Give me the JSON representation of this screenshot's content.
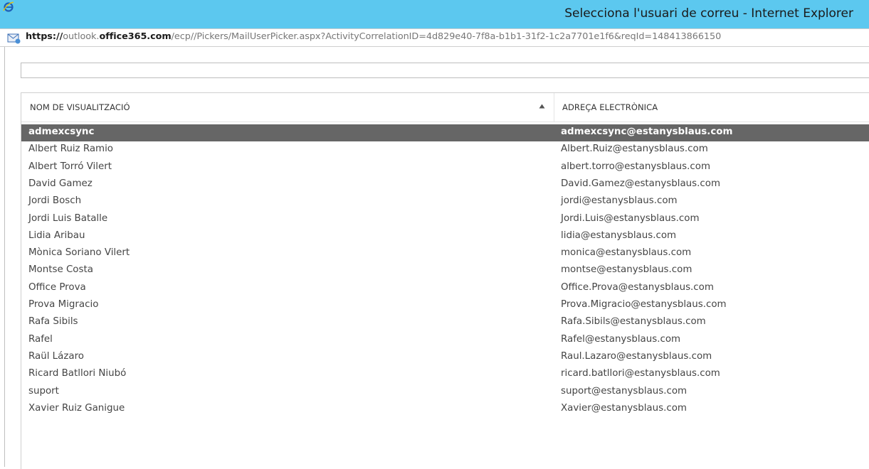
{
  "window": {
    "title": "Selecciona l'usuari de correu - Internet Explorer",
    "browser_icon": "internet-explorer-icon"
  },
  "address": {
    "page_icon": "mail-page-icon",
    "scheme": "https://",
    "pre_host": "outlook.",
    "host": "office365.com",
    "path": "/ecp//Pickers/MailUserPicker.aspx?ActivityCorrelationID=4d829e40-7f8a-b1b1-31f2-1c2a7701e1f6&reqId=148413866150"
  },
  "search": {
    "value": ""
  },
  "table": {
    "columns": [
      "NOM DE VISUALITZACIÓ",
      "ADREÇA ELECTRÒNICA"
    ],
    "sort_icon": "sort-ascending-icon",
    "selected_index": 0,
    "rows": [
      {
        "name": "admexcsync",
        "email": "admexcsync@estanysblaus.com"
      },
      {
        "name": "Albert Ruiz Ramio",
        "email": "Albert.Ruiz@estanysblaus.com"
      },
      {
        "name": "Albert Torró Vilert",
        "email": "albert.torro@estanysblaus.com"
      },
      {
        "name": "David Gamez",
        "email": "David.Gamez@estanysblaus.com"
      },
      {
        "name": "Jordi Bosch",
        "email": "jordi@estanysblaus.com"
      },
      {
        "name": "Jordi Luis Batalle",
        "email": "Jordi.Luis@estanysblaus.com"
      },
      {
        "name": "Lidia Aribau",
        "email": "lidia@estanysblaus.com"
      },
      {
        "name": "Mònica Soriano Vilert",
        "email": "monica@estanysblaus.com"
      },
      {
        "name": "Montse Costa",
        "email": "montse@estanysblaus.com"
      },
      {
        "name": "Office Prova",
        "email": "Office.Prova@estanysblaus.com"
      },
      {
        "name": "Prova Migracio",
        "email": "Prova.Migracio@estanysblaus.com"
      },
      {
        "name": "Rafa Sibils",
        "email": "Rafa.Sibils@estanysblaus.com"
      },
      {
        "name": "Rafel",
        "email": "Rafel@estanysblaus.com"
      },
      {
        "name": "Raül Lázaro",
        "email": "Raul.Lazaro@estanysblaus.com"
      },
      {
        "name": "Ricard Batllori Niubó",
        "email": "ricard.batllori@estanysblaus.com"
      },
      {
        "name": "suport",
        "email": "suport@estanysblaus.com"
      },
      {
        "name": "Xavier Ruiz Ganigue",
        "email": "Xavier@estanysblaus.com"
      }
    ]
  },
  "colors": {
    "titlebar": "#5cc8ef",
    "selected_row": "#666666"
  }
}
